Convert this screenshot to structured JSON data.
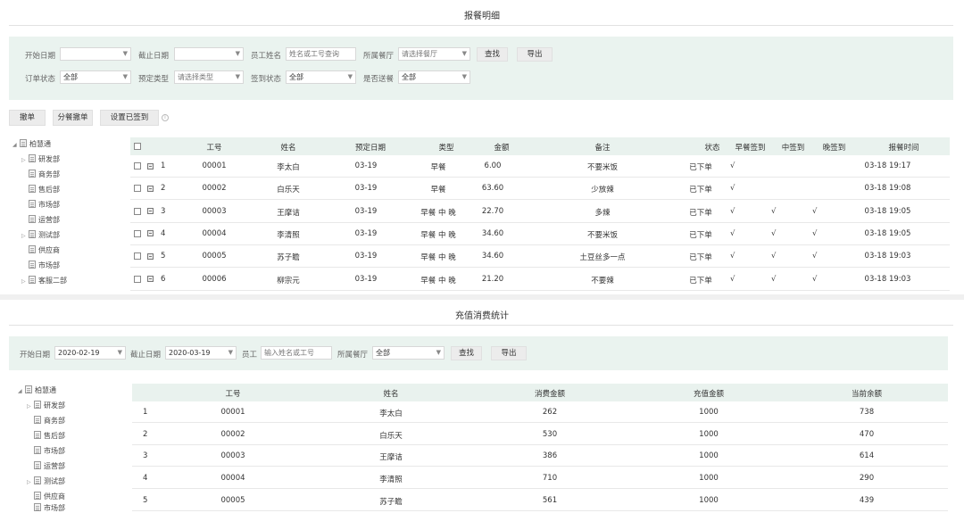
{
  "meal": {
    "title": "报餐明细",
    "filters": {
      "start_date_label": "开始日期",
      "end_date_label": "截止日期",
      "employee_label": "员工姓名",
      "employee_placeholder": "姓名或工号查询",
      "canteen_label": "所属餐厅",
      "canteen_placeholder": "请选择餐厅",
      "search_label": "查找",
      "export_label": "导出",
      "order_status_label": "订单状态",
      "order_status_value": "全部",
      "booking_type_label": "预定类型",
      "booking_type_placeholder": "请选择类型",
      "signin_status_label": "签到状态",
      "signin_status_value": "全部",
      "delivery_label": "是否送餐",
      "delivery_value": "全部"
    },
    "actions": {
      "cancel_label": "撤单",
      "split_cancel_label": "分餐撤单",
      "set_signed_label": "设置已签到"
    },
    "tree": [
      "柏慧通",
      "研发部",
      "商务部",
      "售后部",
      "市场部",
      "运营部",
      "测试部",
      "供应商",
      "市场部",
      "客服二部"
    ],
    "columns": [
      "工号",
      "姓名",
      "预定日期",
      "类型",
      "金额",
      "备注",
      "状态",
      "早餐签到",
      "中签到",
      "晚签到",
      "报餐时间"
    ],
    "rows": [
      {
        "no": "1",
        "id": "00001",
        "name": "李太白",
        "date": "03-19",
        "type": "早餐",
        "amount": "6.00",
        "note": "不要米饭",
        "status": "已下单",
        "b": "√",
        "l": "",
        "d": "",
        "time": "03-18 19:17"
      },
      {
        "no": "2",
        "id": "00002",
        "name": "白乐天",
        "date": "03-19",
        "type": "早餐",
        "amount": "63.60",
        "note": "少放辣",
        "status": "已下单",
        "b": "√",
        "l": "",
        "d": "",
        "time": "03-18 19:08"
      },
      {
        "no": "3",
        "id": "00003",
        "name": "王摩诘",
        "date": "03-19",
        "type": "早餐 中 晚",
        "amount": "22.70",
        "note": "多辣",
        "status": "已下单",
        "b": "√",
        "l": "√",
        "d": "√",
        "time": "03-18 19:05"
      },
      {
        "no": "4",
        "id": "00004",
        "name": "李清照",
        "date": "03-19",
        "type": "早餐 中 晚",
        "amount": "34.60",
        "note": "不要米饭",
        "status": "已下单",
        "b": "√",
        "l": "√",
        "d": "√",
        "time": "03-18 19:05"
      },
      {
        "no": "5",
        "id": "00005",
        "name": "苏子瞻",
        "date": "03-19",
        "type": "早餐 中 晚",
        "amount": "34.60",
        "note": "土豆丝多一点",
        "status": "已下单",
        "b": "√",
        "l": "√",
        "d": "√",
        "time": "03-18 19:03"
      },
      {
        "no": "6",
        "id": "00006",
        "name": "柳宗元",
        "date": "03-19",
        "type": "早餐 中 晚",
        "amount": "21.20",
        "note": "不要辣",
        "status": "已下单",
        "b": "√",
        "l": "√",
        "d": "√",
        "time": "03-18 19:03"
      }
    ]
  },
  "recharge": {
    "title": "充值消费统计",
    "filters": {
      "start_date_label": "开始日期",
      "start_date_value": "2020-02-19",
      "end_date_label": "截止日期",
      "end_date_value": "2020-03-19",
      "employee_label": "员工",
      "employee_placeholder": "输入姓名或工号",
      "canteen_label": "所属餐厅",
      "canteen_value": "全部",
      "search_label": "查找",
      "export_label": "导出"
    },
    "tree": [
      "柏慧通",
      "研发部",
      "商务部",
      "售后部",
      "市场部",
      "运营部",
      "测试部",
      "供应商",
      "市场部"
    ],
    "columns": [
      "工号",
      "姓名",
      "消费金额",
      "充值金额",
      "当前余额"
    ],
    "rows": [
      {
        "no": "1",
        "id": "00001",
        "name": "李太白",
        "spend": "262",
        "recharge": "1000",
        "balance": "738"
      },
      {
        "no": "2",
        "id": "00002",
        "name": "白乐天",
        "spend": "530",
        "recharge": "1000",
        "balance": "470"
      },
      {
        "no": "3",
        "id": "00003",
        "name": "王摩诘",
        "spend": "386",
        "recharge": "1000",
        "balance": "614"
      },
      {
        "no": "4",
        "id": "00004",
        "name": "李清照",
        "spend": "710",
        "recharge": "1000",
        "balance": "290"
      },
      {
        "no": "5",
        "id": "00005",
        "name": "苏子瞻",
        "spend": "561",
        "recharge": "1000",
        "balance": "439"
      }
    ]
  }
}
